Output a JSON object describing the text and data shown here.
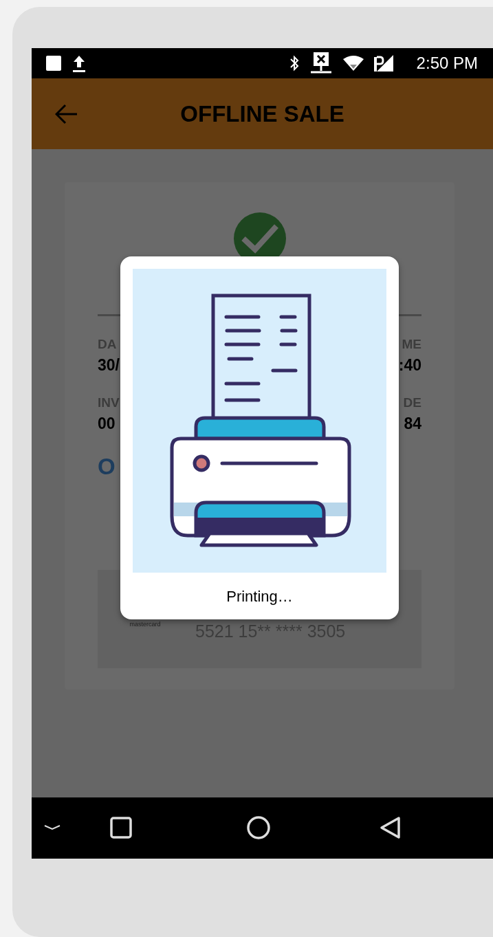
{
  "status_bar": {
    "time": "2:50 PM"
  },
  "app_bar": {
    "title": "OFFLINE SALE"
  },
  "receipt": {
    "rows": [
      {
        "left": {
          "label": "DA",
          "value": "30/"
        },
        "right": {
          "label": "ME",
          "value": ":40"
        }
      },
      {
        "left": {
          "label": "INV",
          "value": "00"
        },
        "right": {
          "label": "DE",
          "value": "84"
        }
      }
    ],
    "heading": "O",
    "card": {
      "brand": "mastercard",
      "number": "5521 15** **** 3505"
    }
  },
  "dialog": {
    "message": "Printing…"
  }
}
